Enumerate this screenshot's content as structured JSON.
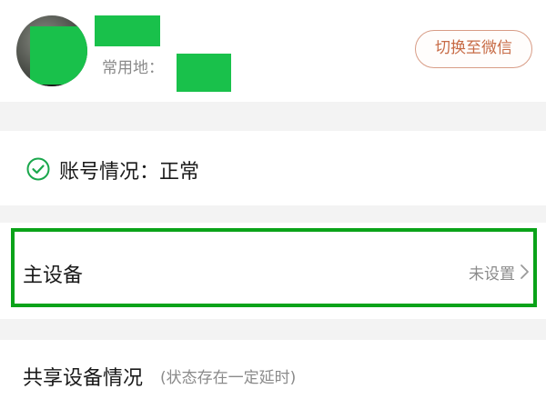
{
  "profile": {
    "location_label": "常用地：",
    "switch_button_label": "切换至微信"
  },
  "account_status": {
    "label": "账号情况：正常",
    "icon": "check-circle-icon"
  },
  "primary_device": {
    "label": "主设备",
    "value": "未设置",
    "icon": "chevron-right-icon"
  },
  "shared_devices": {
    "label": "共享设备情况",
    "note": "(状态存在一定延时)"
  },
  "colors": {
    "mask_green": "#19c14b",
    "highlight_border": "#0aa319",
    "accent_button": "#c76b46",
    "status_icon": "#1aa74c",
    "text_gray": "#8a8a8a",
    "background": "#f3f3f3"
  }
}
